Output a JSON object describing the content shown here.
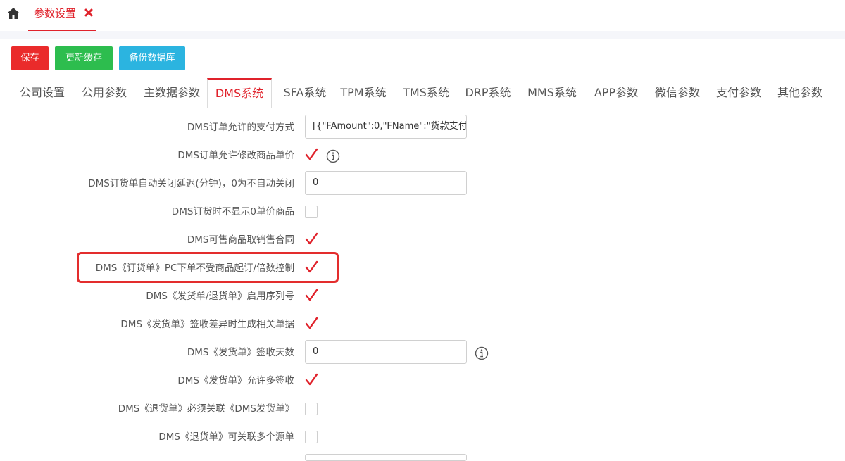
{
  "top_tab": {
    "label": "参数设置"
  },
  "toolbar": {
    "save": "保存",
    "refresh_cache": "更新缓存",
    "backup_db": "备份数据库"
  },
  "module_tabs": [
    "公司设置",
    "公用参数",
    "主数据参数",
    "DMS系统",
    "SFA系统",
    "TPM系统",
    "TMS系统",
    "DRP系统",
    "MMS系统",
    "APP参数",
    "微信参数",
    "支付参数",
    "其他参数"
  ],
  "active_tab": "DMS系统",
  "settings": [
    {
      "label": "DMS订单允许的支付方式",
      "type": "text",
      "value": "[{\"FAmount\":0,\"FName\":\"货款支付"
    },
    {
      "label": "DMS订单允许修改商品单价",
      "type": "checkbox",
      "checked": true,
      "info": true
    },
    {
      "label": "DMS订货单自动关闭延迟(分钟)，0为不自动关闭",
      "type": "text",
      "value": "0"
    },
    {
      "label": "DMS订货时不显示0单价商品",
      "type": "checkbox",
      "checked": false
    },
    {
      "label": "DMS可售商品取销售合同",
      "type": "checkbox",
      "checked": true
    },
    {
      "label": "DMS《订货单》PC下单不受商品起订/倍数控制",
      "type": "checkbox",
      "checked": true,
      "highlighted": true
    },
    {
      "label": "DMS《发货单/退货单》启用序列号",
      "type": "checkbox",
      "checked": true
    },
    {
      "label": "DMS《发货单》签收差异时生成相关单据",
      "type": "checkbox",
      "checked": true
    },
    {
      "label": "DMS《发货单》签收天数",
      "type": "text",
      "value": "0",
      "info": true
    },
    {
      "label": "DMS《发货单》允许多签收",
      "type": "checkbox",
      "checked": true
    },
    {
      "label": "DMS《退货单》必须关联《DMS发货单》",
      "type": "checkbox",
      "checked": false
    },
    {
      "label": "DMS《退货单》可关联多个源单",
      "type": "checkbox",
      "checked": false
    }
  ],
  "colors": {
    "accent": "#e0222b",
    "save": "#ea2b2b",
    "refresh": "#2dbd4e",
    "backup": "#2bb4e0"
  },
  "icons": {
    "home": "home-icon",
    "close": "close-icon",
    "check": "check-icon",
    "info": "info-icon"
  }
}
